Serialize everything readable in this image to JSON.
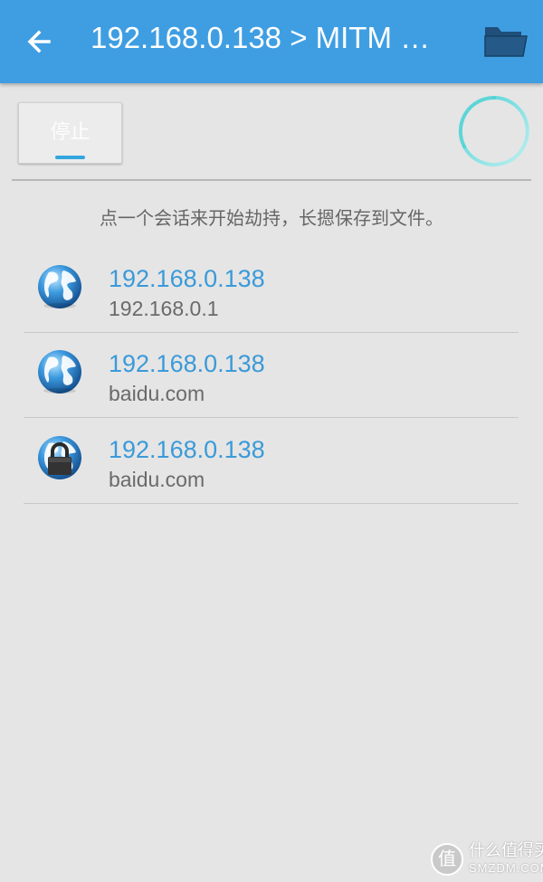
{
  "appbar": {
    "title": "192.168.0.138 > MITM …",
    "back_icon": "arrow-left-icon",
    "folder_icon": "folder-open-icon",
    "background": "#3f9ee2"
  },
  "controls": {
    "stop_label": "停止",
    "spinner_icon": "loading-spinner-icon",
    "spinner_color": "#4fd2d4"
  },
  "hint": "点一个会话来开始劫持，长摁保存到文件。",
  "sessions": [
    {
      "ip": "192.168.0.138",
      "host": "192.168.0.1",
      "icon": "globe-icon"
    },
    {
      "ip": "192.168.0.138",
      "host": "baidu.com",
      "icon": "globe-icon"
    },
    {
      "ip": "192.168.0.138",
      "host": "baidu.com",
      "icon": "globe-lock-icon"
    }
  ],
  "watermark": {
    "glyph": "值",
    "text_cn": "什么值得买",
    "text_en": "SMZDM.COM"
  },
  "colors": {
    "accent": "#3a9ad9",
    "link_text": "#3a9ad9",
    "secondary_text": "#6a6a6a",
    "page_background": "#e5e5e5"
  }
}
